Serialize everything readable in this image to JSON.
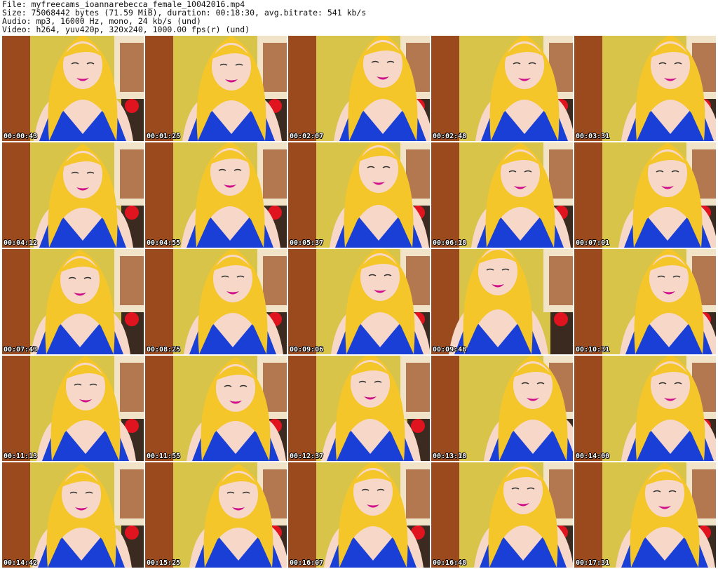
{
  "header": {
    "file_line": "File: myfreecams_ioannarebecca_female_10042016.mp4",
    "size_line": "Size: 75068442 bytes (71.59 MiB), duration: 00:18:30, avg.bitrate: 541 kb/s",
    "audio_line": "Audio: mp3, 16000 Hz, mono, 24 kb/s (und)",
    "video_line": "Video: h264, yuv420p, 320x240, 1000.00 fps(r) (und)"
  },
  "colors": {
    "hair": "#f4c62a",
    "dress": "#1a3fd6",
    "skin": "#f7d8c8",
    "lips": "#d0108a",
    "wall": "#d9c44a",
    "furniture": "#9a4a1c",
    "pillow": "#e0141e"
  },
  "thumbnails": [
    {
      "timestamp": "00:00:43"
    },
    {
      "timestamp": "00:01:25"
    },
    {
      "timestamp": "00:02:07"
    },
    {
      "timestamp": "00:02:48"
    },
    {
      "timestamp": "00:03:31"
    },
    {
      "timestamp": "00:04:12"
    },
    {
      "timestamp": "00:04:55"
    },
    {
      "timestamp": "00:05:37"
    },
    {
      "timestamp": "00:06:18"
    },
    {
      "timestamp": "00:07:01"
    },
    {
      "timestamp": "00:07:43"
    },
    {
      "timestamp": "00:08:25"
    },
    {
      "timestamp": "00:09:06"
    },
    {
      "timestamp": "00:09:48"
    },
    {
      "timestamp": "00:10:31"
    },
    {
      "timestamp": "00:11:13"
    },
    {
      "timestamp": "00:11:55"
    },
    {
      "timestamp": "00:12:37"
    },
    {
      "timestamp": "00:13:18"
    },
    {
      "timestamp": "00:14:00"
    },
    {
      "timestamp": "00:14:42"
    },
    {
      "timestamp": "00:15:25"
    },
    {
      "timestamp": "00:16:07"
    },
    {
      "timestamp": "00:16:48"
    },
    {
      "timestamp": "00:17:31"
    }
  ]
}
